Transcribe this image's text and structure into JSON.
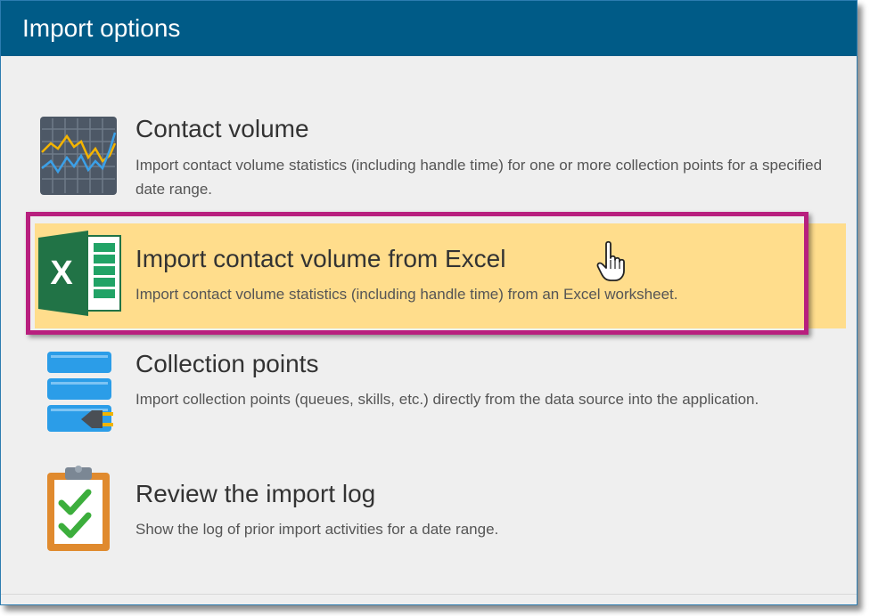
{
  "window": {
    "title": "Import options"
  },
  "options": [
    {
      "title": "Contact volume",
      "description": "Import contact volume statistics (including handle time) for one or more collection points for a specified date range.",
      "icon": "chart-grid-icon"
    },
    {
      "title": "Import contact volume from Excel",
      "description": "Import contact volume statistics (including handle time) from an Excel worksheet.",
      "icon": "excel-icon",
      "highlighted": true
    },
    {
      "title": "Collection points",
      "description": "Import collection points (queues, skills, etc.) directly from the data source into the application.",
      "icon": "database-plug-icon"
    },
    {
      "title": "Review the import log",
      "description": "Show the log of prior import activities for a date range.",
      "icon": "clipboard-check-icon"
    }
  ],
  "colors": {
    "header": "#005b87",
    "highlight": "#ffdd8c",
    "highlight_border": "#b81f7e"
  }
}
